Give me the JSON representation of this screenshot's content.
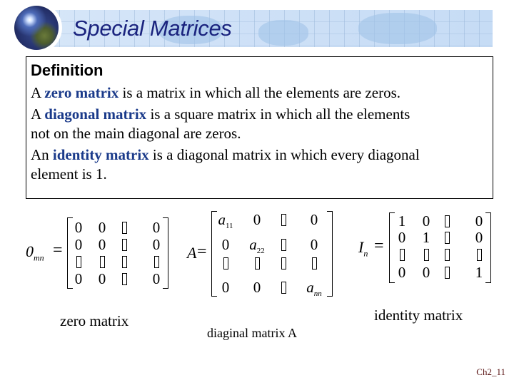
{
  "header": {
    "title": "Special Matrices",
    "logo_icon": "globe-icon"
  },
  "definition": {
    "heading": "Definition",
    "items": [
      {
        "prefix": "A ",
        "term": "zero matrix",
        "rest": " is a matrix in which all the elements are zeros."
      },
      {
        "prefix": "A ",
        "term": "diagonal matrix",
        "rest": " is a square matrix in which all the elements",
        "continuation": "not on the main diagonal are zeros."
      },
      {
        "prefix": "An ",
        "term": "identity matrix",
        "rest": " is a diagonal matrix in which every diagonal",
        "continuation": "element is 1."
      }
    ],
    "term_color": "#1a3a8a"
  },
  "matrices": {
    "zero": {
      "symbol": "0",
      "subscript": "mn",
      "equals": "=",
      "rows": [
        [
          "0",
          "0",
          "▯",
          "0"
        ],
        [
          "0",
          "0",
          "▯",
          "0"
        ],
        [
          "▯",
          "▯",
          "▯",
          "▯"
        ],
        [
          "0",
          "0",
          "▯",
          "0"
        ]
      ],
      "caption": "zero matrix"
    },
    "diagonal": {
      "symbol": "A",
      "equals": "=",
      "rows": [
        [
          "a|11",
          "0",
          "▯",
          "0"
        ],
        [
          "0",
          "a|22",
          "▯",
          "0"
        ],
        [
          "▯",
          "▯",
          "▯",
          "▯"
        ],
        [
          "0",
          "0",
          "▯",
          "a|nn"
        ]
      ],
      "caption": "diaginal matrix A"
    },
    "identity": {
      "symbol": "I",
      "subscript": "n",
      "equals": "=",
      "rows": [
        [
          "1",
          "0",
          "▯",
          "0"
        ],
        [
          "0",
          "1",
          "▯",
          "0"
        ],
        [
          "▯",
          "▯",
          "▯",
          "▯"
        ],
        [
          "0",
          "0",
          "▯",
          "1"
        ]
      ],
      "caption": "identity matrix"
    }
  },
  "footer": {
    "page_label": "Ch2_11"
  }
}
